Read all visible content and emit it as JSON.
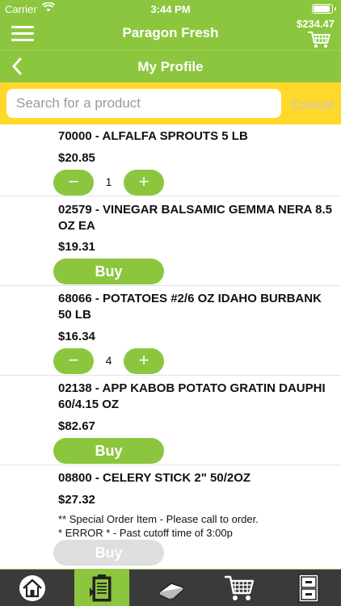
{
  "status_bar": {
    "carrier": "Carrier",
    "time": "3:44 PM",
    "wifi_icon": "wifi-icon",
    "battery_icon": "battery-icon"
  },
  "header": {
    "app_title": "Paragon Fresh",
    "cart_total": "$234.47",
    "menu_icon": "hamburger-menu-icon",
    "cart_icon": "shopping-cart-icon"
  },
  "subheader": {
    "title": "My Profile",
    "back_icon": "chevron-left-icon"
  },
  "search": {
    "placeholder": "Search for a product",
    "value": "",
    "cancel_label": "Cancel"
  },
  "colors": {
    "accent": "#8cc63f",
    "search_bar": "#ffd82a",
    "tab_bar": "#3a3a3a",
    "disabled": "#dedede"
  },
  "products": [
    {
      "title": "70000 - ALFALFA SPROUTS 5 LB",
      "price": "$20.85",
      "control": "stepper",
      "quantity": "1"
    },
    {
      "title": "02579 - VINEGAR BALSAMIC GEMMA NERA 8.5 OZ EA",
      "price": "$19.31",
      "control": "buy",
      "buy_label": "Buy"
    },
    {
      "title": "68066 - POTATOES #2/6 OZ IDAHO BURBANK 50 LB",
      "price": "$16.34",
      "control": "stepper",
      "quantity": "4"
    },
    {
      "title": "02138 - APP KABOB POTATO GRATIN DAUPHI 60/4.15 OZ",
      "price": "$82.67",
      "control": "buy",
      "buy_label": "Buy"
    },
    {
      "title": "08800 - CELERY STICK 2\" 50/2OZ",
      "price": "$27.32",
      "control": "buy-disabled",
      "buy_label": "Buy",
      "notes": [
        "** Special Order Item - Please call to order.",
        "* ERROR * - Past cutoff time of  3:00p"
      ]
    }
  ],
  "stepper": {
    "minus": "−",
    "plus": "+"
  },
  "tabs": [
    {
      "name": "home",
      "icon": "home-icon",
      "active": false
    },
    {
      "name": "order-guide",
      "icon": "clipboard-list-icon",
      "active": true
    },
    {
      "name": "catalog",
      "icon": "book-icon",
      "active": false
    },
    {
      "name": "cart",
      "icon": "shopping-cart-icon",
      "active": false
    },
    {
      "name": "orders",
      "icon": "file-cabinet-icon",
      "active": false
    }
  ]
}
